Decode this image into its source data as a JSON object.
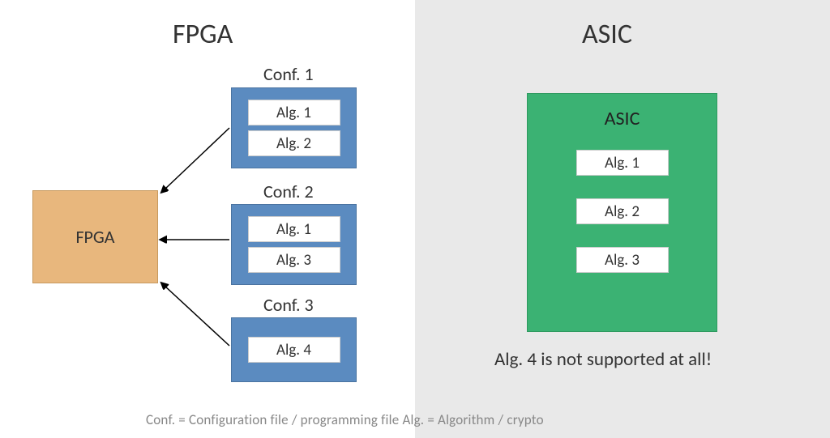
{
  "fpga": {
    "title": "FPGA",
    "box_label": "FPGA",
    "configs": [
      {
        "label": "Conf. 1",
        "algs": [
          "Alg. 1",
          "Alg. 2"
        ]
      },
      {
        "label": "Conf. 2",
        "algs": [
          "Alg. 1",
          "Alg. 3"
        ]
      },
      {
        "label": "Conf. 3",
        "algs": [
          "Alg. 4"
        ]
      }
    ]
  },
  "asic": {
    "title": "ASIC",
    "box_label": "ASIC",
    "algs": [
      "Alg. 1",
      "Alg. 2",
      "Alg. 3"
    ],
    "note": "Alg. 4 is not supported at all!"
  },
  "legend": "Conf. = Configuration file / programming file    Alg. = Algorithm / crypto"
}
